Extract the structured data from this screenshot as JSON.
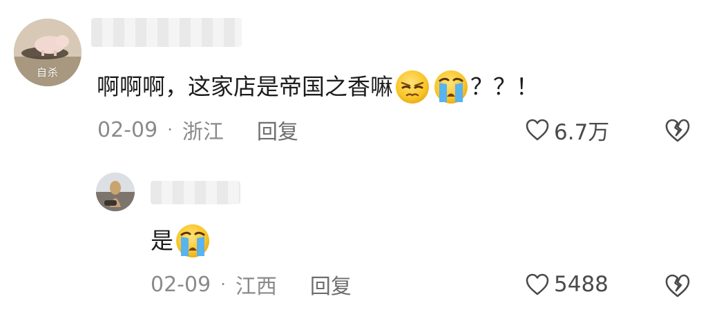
{
  "comments": [
    {
      "avatar_badge": "自杀",
      "text": "啊啊啊，这家店是帝国之香嘛",
      "emojis": [
        "smirk-emoji",
        "crying-emoji"
      ],
      "suffix": "？？！",
      "date": "02-09",
      "separator": "·",
      "location": "浙江",
      "reply_label": "回复",
      "likes": "6.7万"
    },
    {
      "text": "是",
      "emojis": [
        "crying-emoji"
      ],
      "date": "02-09",
      "separator": "·",
      "location": "江西",
      "reply_label": "回复",
      "likes": "5488"
    }
  ],
  "colors": {
    "text": "#1c1c1c",
    "meta": "#8a8a8a",
    "icon": "#4a4a4a",
    "emoji_yellow": "#f7c62a",
    "tear_blue": "#5aaee8"
  }
}
